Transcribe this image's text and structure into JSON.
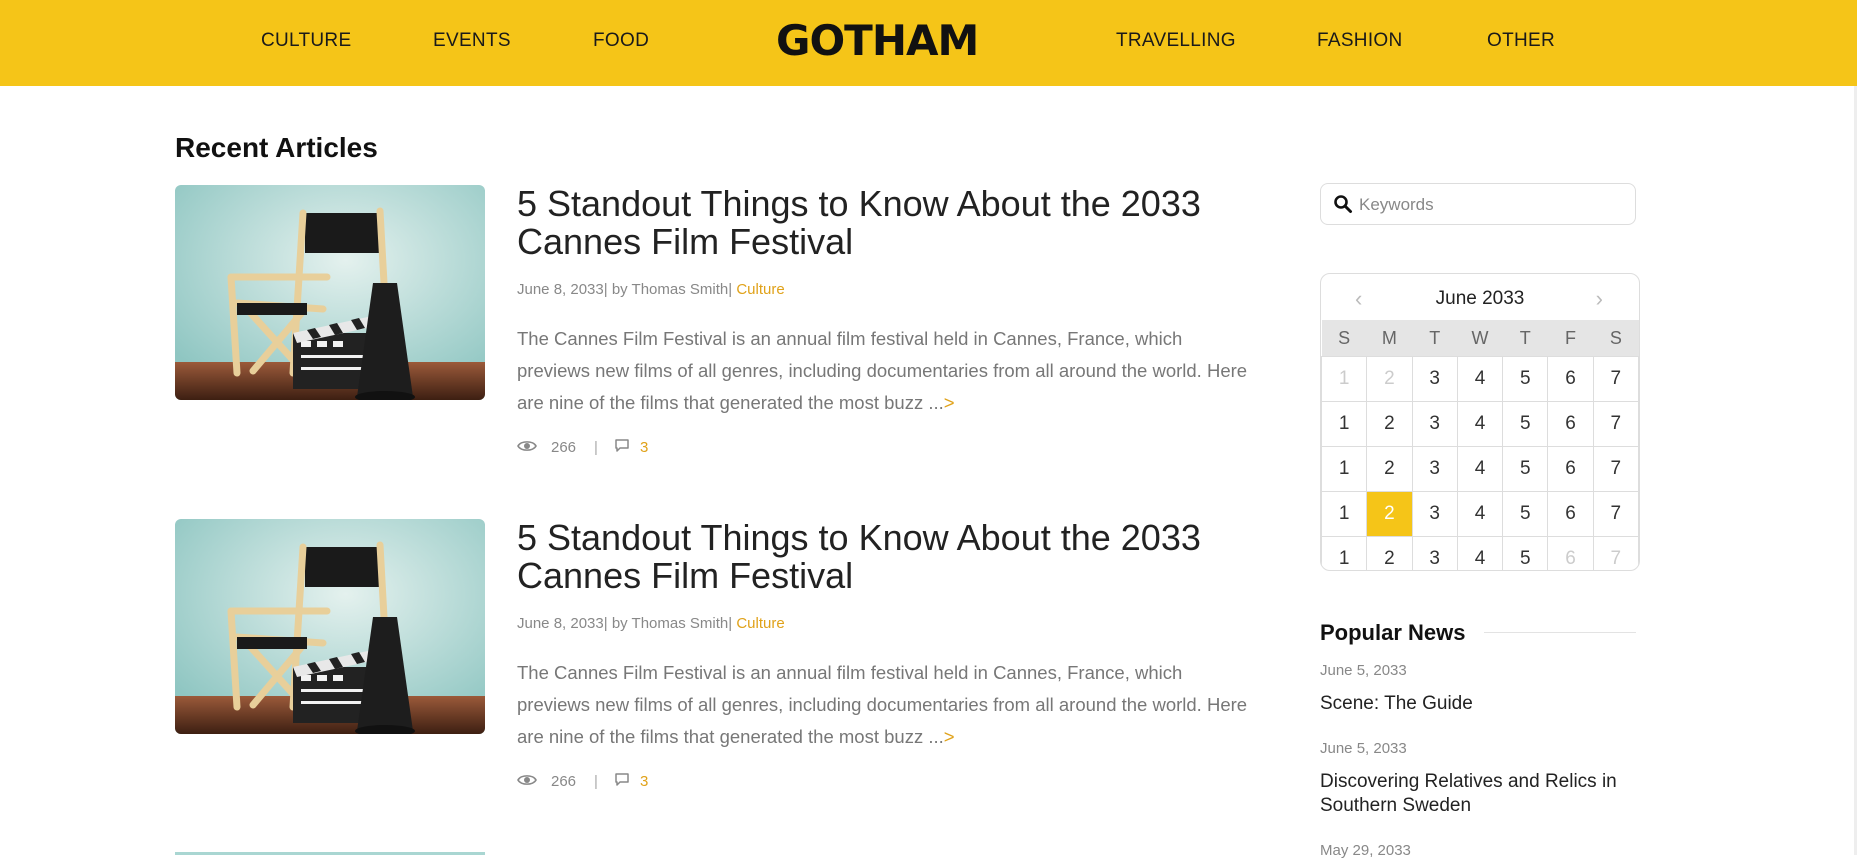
{
  "nav": {
    "left": [
      "CULTURE",
      "EVENTS",
      "FOOD"
    ],
    "logo": "GOTHAM",
    "right": [
      "TRAVELLING",
      "FASHION",
      "OTHER"
    ]
  },
  "main": {
    "section_title": "Recent Articles",
    "articles": [
      {
        "title": "5 Standout Things to Know About the 2033 Cannes Film Festival",
        "date": "June 8, 2033",
        "author": "| by Thomas Smith|",
        "category": "Culture",
        "excerpt": "The Cannes Film Festival is an annual film festival held in Cannes, France, which previews new films of all genres, including documentaries from all around the world. Here are nine of the films that generated the most buzz ...",
        "more": ">",
        "views": "266",
        "separator": "|",
        "comments": "3"
      },
      {
        "title": "5 Standout Things to Know About the 2033 Cannes Film Festival",
        "date": "June 8, 2033",
        "author": "| by Thomas Smith|",
        "category": "Culture",
        "excerpt": "The Cannes Film Festival is an annual film festival held in Cannes, France, which previews new films of all genres, including documentaries from all around the world. Here are nine of the films that generated the most buzz ...",
        "more": ">",
        "views": "266",
        "separator": "|",
        "comments": "3"
      }
    ]
  },
  "sidebar": {
    "search": {
      "placeholder": "Keywords",
      "value": ""
    },
    "calendar": {
      "title": "June 2033",
      "prev": "‹",
      "next": "›",
      "weekdays": [
        "S",
        "M",
        "T",
        "W",
        "T",
        "F",
        "S"
      ],
      "weeks": [
        [
          {
            "d": "1",
            "muted": true
          },
          {
            "d": "2",
            "muted": true
          },
          {
            "d": "3"
          },
          {
            "d": "4"
          },
          {
            "d": "5"
          },
          {
            "d": "6"
          },
          {
            "d": "7"
          }
        ],
        [
          {
            "d": "1"
          },
          {
            "d": "2"
          },
          {
            "d": "3"
          },
          {
            "d": "4"
          },
          {
            "d": "5"
          },
          {
            "d": "6"
          },
          {
            "d": "7"
          }
        ],
        [
          {
            "d": "1"
          },
          {
            "d": "2"
          },
          {
            "d": "3"
          },
          {
            "d": "4"
          },
          {
            "d": "5"
          },
          {
            "d": "6"
          },
          {
            "d": "7"
          }
        ],
        [
          {
            "d": "1"
          },
          {
            "d": "2",
            "selected": true
          },
          {
            "d": "3"
          },
          {
            "d": "4"
          },
          {
            "d": "5"
          },
          {
            "d": "6"
          },
          {
            "d": "7"
          }
        ],
        [
          {
            "d": "1"
          },
          {
            "d": "2"
          },
          {
            "d": "3"
          },
          {
            "d": "4"
          },
          {
            "d": "5"
          },
          {
            "d": "6",
            "muted": true
          },
          {
            "d": "7",
            "muted": true
          }
        ]
      ]
    },
    "popular": {
      "title": "Popular News",
      "items": [
        {
          "date": "June 5, 2033",
          "headline": "Scene: The Guide"
        },
        {
          "date": "June 5, 2033",
          "headline": "Discovering Relatives and Relics in Southern Sweden"
        },
        {
          "date": "May 29, 2033",
          "headline": ""
        }
      ]
    }
  },
  "colors": {
    "accent": "#f5c518",
    "link": "#e0a21a",
    "muted_text": "#888888"
  }
}
